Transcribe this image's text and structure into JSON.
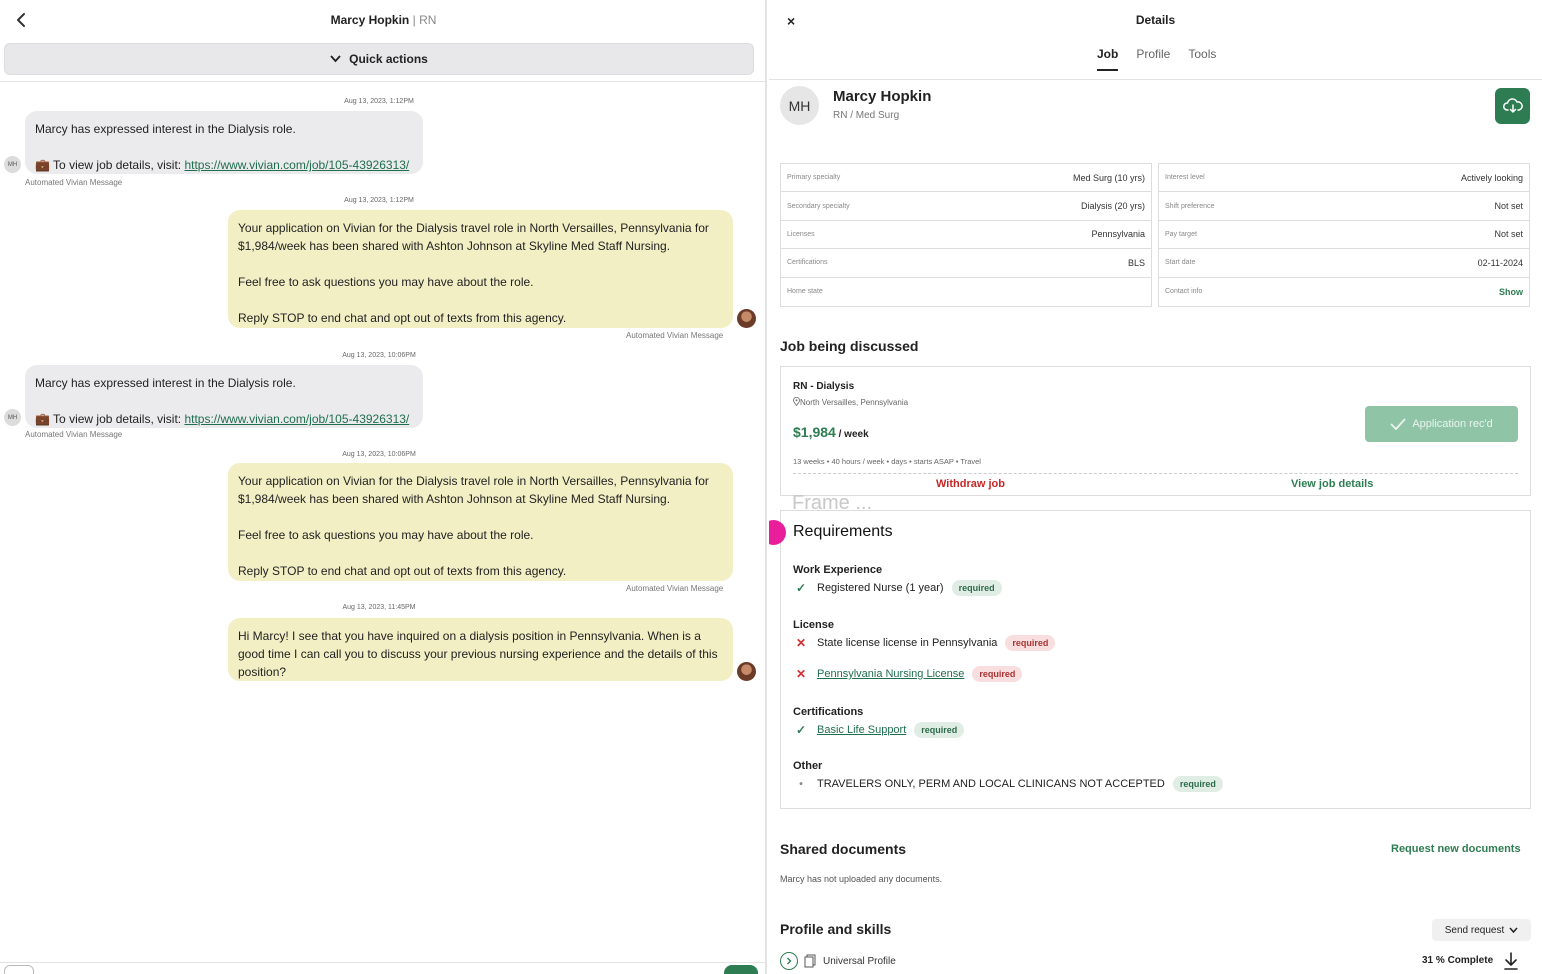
{
  "chat": {
    "header_name": "Marcy Hopkin",
    "header_sep": "|",
    "header_role": "RN",
    "quick_actions_label": "Quick actions",
    "auto_label": "Automated Vivian Message",
    "avatar_initials": "MH",
    "messages": [
      {
        "timestamp": "Aug 13, 2023, 1:12PM",
        "line1": "Marcy has expressed interest in the Dialysis role.",
        "line2_prefix": "💼 To view job details, visit: ",
        "link": "https://www.vivian.com/job/105-43926313/"
      },
      {
        "timestamp": "Aug 13, 2023, 1:12PM",
        "p1": "Your application on Vivian for the Dialysis travel role in North Versailles, Pennsylvania for $1,984/week has been shared with Ashton Johnson at Skyline Med Staff Nursing.",
        "p2": "Feel free to ask questions you may have about the role.",
        "p3": "Reply STOP to end chat and opt out of texts from this agency."
      },
      {
        "timestamp": "Aug 13, 2023, 10:06PM",
        "line1": "Marcy has expressed interest in the Dialysis role.",
        "line2_prefix": "💼 To view job details, visit: ",
        "link": "https://www.vivian.com/job/105-43926313/"
      },
      {
        "timestamp": "Aug 13, 2023, 10:06PM",
        "p1": "Your application on Vivian for the Dialysis travel role in North Versailles, Pennsylvania for $1,984/week has been shared with Ashton Johnson at Skyline Med Staff Nursing.",
        "p2": "Feel free to ask questions you may have about the role.",
        "p3": "Reply STOP to end chat and opt out of texts from this agency."
      },
      {
        "timestamp": "Aug 13, 2023, 11:45PM",
        "p1": "Hi Marcy! I see that you have inquired on a dialysis position in Pennsylvania. When is a good time I can call you to discuss your previous nursing experience and the details of this position?"
      }
    ]
  },
  "details": {
    "title": "Details",
    "close_icon": "×",
    "tabs": [
      "Job",
      "Profile",
      "Tools"
    ],
    "profile": {
      "initials": "MH",
      "name": "Marcy Hopkin",
      "sub": "RN / Med Surg"
    },
    "left_info": [
      {
        "label": "Primary specialty",
        "value": "Med Surg (10 yrs)"
      },
      {
        "label": "Secondary specialty",
        "value": "Dialysis (20 yrs)"
      },
      {
        "label": "Licenses",
        "value": "Pennsylvania"
      },
      {
        "label": "Certifications",
        "value": "BLS"
      },
      {
        "label": "Home state",
        "value": ""
      }
    ],
    "right_info": [
      {
        "label": "Interest level",
        "value": "Actively looking"
      },
      {
        "label": "Shift preference",
        "value": "Not set"
      },
      {
        "label": "Pay target",
        "value": "Not set"
      },
      {
        "label": "Start date",
        "value": "02-11-2024"
      },
      {
        "label": "Contact info",
        "value": "Show"
      }
    ],
    "job_section_title": "Job being discussed",
    "job": {
      "role": "RN - Dialysis",
      "location": "North Versailles, Pennsylvania",
      "pay": "$1,984",
      "pay_unit": " / week",
      "meta": "13 weeks • 40 hours / week • days • starts ASAP • Travel",
      "status_button": "Application rec'd",
      "withdraw": "Withdraw job",
      "view": "View job details"
    },
    "frame_label": "Frame ...",
    "requirements": {
      "title": "Requirements",
      "work_experience_title": "Work Experience",
      "work_experience_item": "Registered Nurse (1 year)",
      "license_title": "License",
      "license_item_1": "State license license in Pennsylvania",
      "license_item_2": "Pennsylvania Nursing License",
      "certifications_title": "Certifications",
      "cert_item": "Basic Life Support",
      "other_title": "Other",
      "other_item": "TRAVELERS ONLY, PERM AND LOCAL CLINICANS NOT ACCEPTED",
      "required_label": "required"
    },
    "shared_docs_title": "Shared documents",
    "request_docs_label": "Request new documents",
    "docs_empty": "Marcy has not uploaded any documents.",
    "profile_skills_title": "Profile and skills",
    "send_request_label": "Send request",
    "universal_profile": "Universal Profile",
    "complete_label": "31 % Complete"
  },
  "colors": {
    "brand_green": "#2e7d52",
    "outgoing_bubble": "#f3efc5",
    "incoming_bubble": "#ebebed",
    "alert_red": "#c62828",
    "annotation_pink": "#e91e9b"
  }
}
